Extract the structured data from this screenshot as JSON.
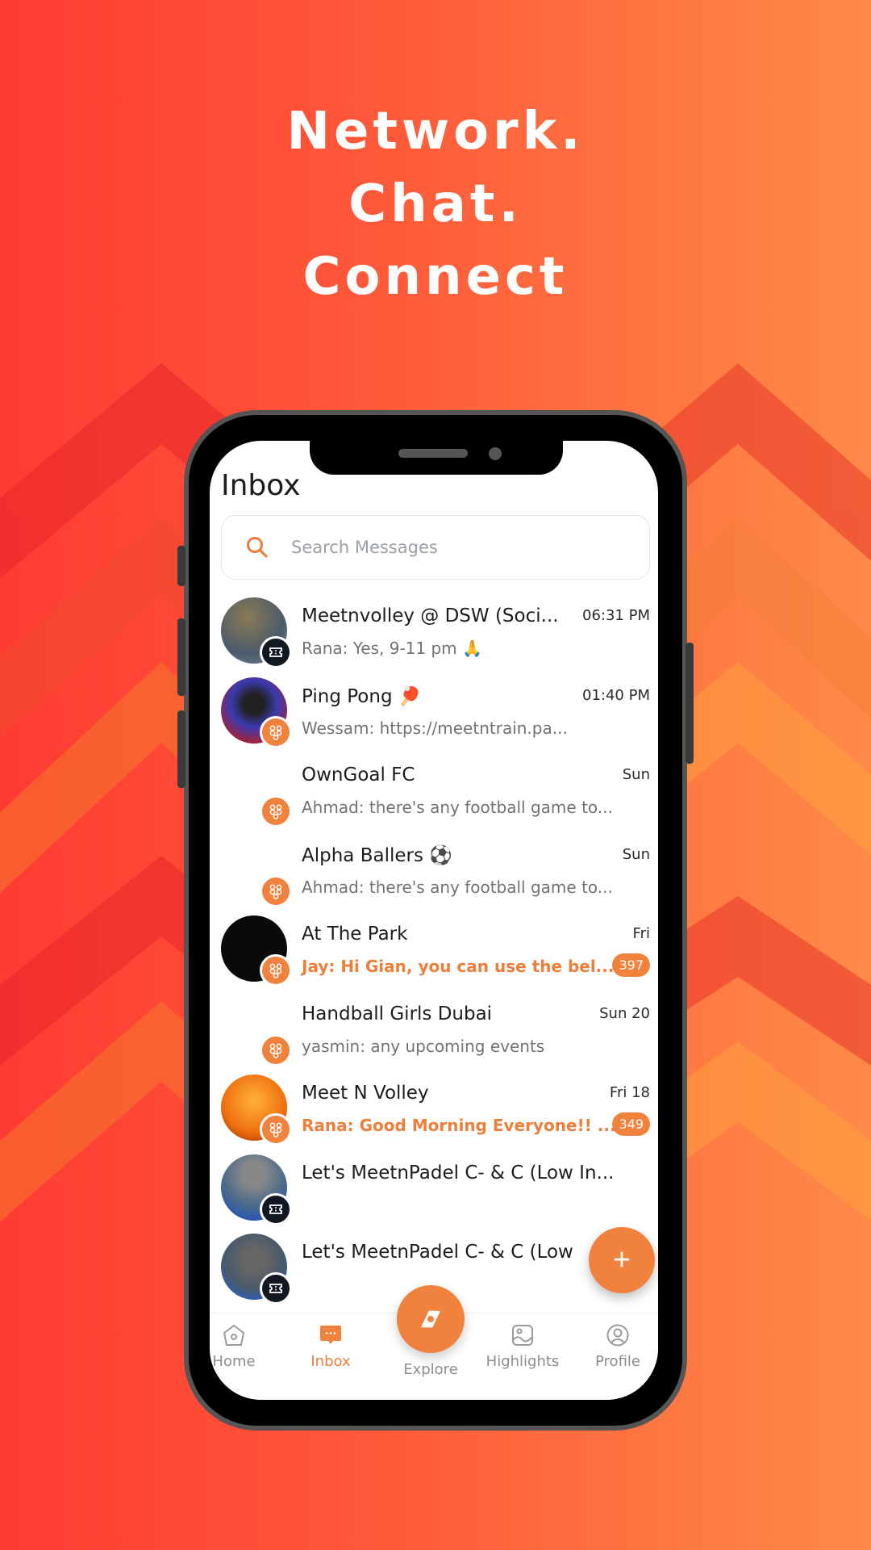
{
  "headline": [
    "Network.",
    "Chat.",
    "Connect"
  ],
  "colors": {
    "accent": "#f0823e",
    "bg_start": "#ff3b33",
    "bg_end": "#ff8a48"
  },
  "inbox": {
    "title": "Inbox",
    "search_placeholder": "Search Messages",
    "conversations": [
      {
        "name": "Meetnvolley @ DSW (Soci...",
        "preview": "Rana: Yes, 9-11 pm 🙏",
        "time": "06:31 PM",
        "badge": "ticket-icon",
        "unread": false,
        "count": null
      },
      {
        "name": "Ping Pong 🏓",
        "preview": "Wessam: https://meetntrain.pa...",
        "time": "01:40 PM",
        "badge": "group-icon",
        "unread": false,
        "count": null
      },
      {
        "name": "OwnGoal FC",
        "preview": "Ahmad: there's any football game to...",
        "time": "Sun",
        "badge": "group-icon",
        "unread": false,
        "count": null
      },
      {
        "name": "Alpha Ballers ⚽",
        "preview": "Ahmad: there's any football game to...",
        "time": "Sun",
        "badge": "group-icon",
        "unread": false,
        "count": null
      },
      {
        "name": "At The Park",
        "preview": "Jay: Hi Gian, you can use the bel...",
        "time": "Fri",
        "badge": "group-icon",
        "unread": true,
        "count": "397"
      },
      {
        "name": "Handball Girls Dubai",
        "preview": "yasmin: any upcoming events",
        "time": "Sun 20",
        "badge": "group-icon",
        "unread": false,
        "count": null
      },
      {
        "name": "Meet N Volley",
        "preview": "Rana: Good Morning Everyone!! ...",
        "time": "Fri 18",
        "badge": "group-icon",
        "unread": true,
        "count": "349"
      },
      {
        "name": "Let's MeetnPadel C- & C (Low In...",
        "preview": "",
        "time": "",
        "badge": "ticket-icon",
        "unread": false,
        "count": null
      },
      {
        "name": "Let's MeetnPadel C- & C (Low",
        "preview": "",
        "time": "",
        "badge": "ticket-icon",
        "unread": false,
        "count": null
      }
    ]
  },
  "fab": {
    "label": "+"
  },
  "tabs": [
    {
      "label": "Home",
      "icon": "home-icon"
    },
    {
      "label": "Inbox",
      "icon": "chat-bubble-icon",
      "active": true
    },
    {
      "label": "Explore",
      "icon": "compass-icon"
    },
    {
      "label": "Highlights",
      "icon": "image-icon"
    },
    {
      "label": "Profile",
      "icon": "user-circle-icon"
    }
  ]
}
